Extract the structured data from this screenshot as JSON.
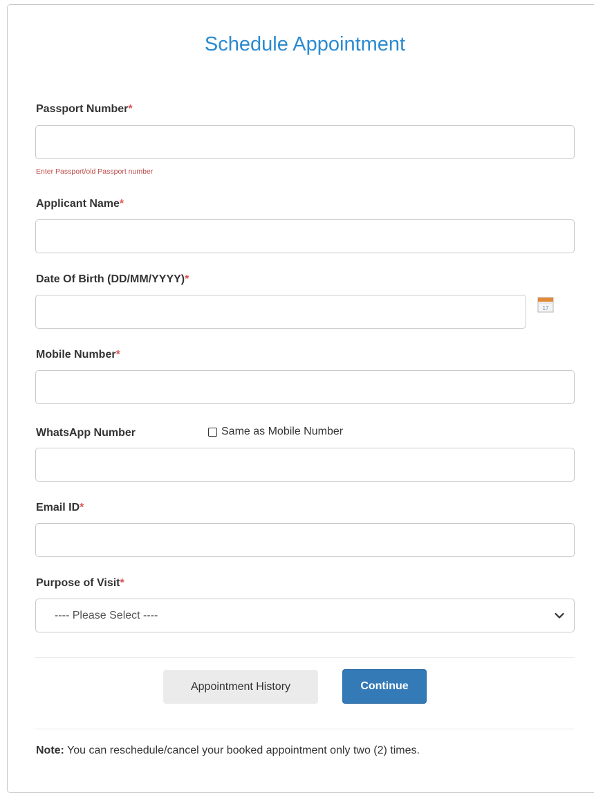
{
  "form": {
    "title": "Schedule Appointment",
    "passport": {
      "label": "Passport Number",
      "required": "*",
      "value": "",
      "hint": "Enter Passport/old Passport number"
    },
    "applicant": {
      "label": "Applicant Name",
      "required": "*",
      "value": ""
    },
    "dob": {
      "label": "Date Of Birth (DD/MM/YYYY)",
      "required": "*",
      "value": "",
      "calendar_icon": "calendar-icon",
      "calendar_day": "17"
    },
    "mobile": {
      "label": "Mobile Number",
      "required": "*",
      "value": ""
    },
    "whatsapp": {
      "label": "WhatsApp Number",
      "value": "",
      "same_checkbox_label": "Same as Mobile Number",
      "same_checked": false
    },
    "email": {
      "label": "Email ID",
      "required": "*",
      "value": ""
    },
    "purpose": {
      "label": "Purpose of Visit",
      "required": "*",
      "selected": "---- Please Select ----",
      "dropdown_icon": "chevron-down-icon"
    }
  },
  "buttons": {
    "history": "Appointment History",
    "continue": "Continue"
  },
  "note": {
    "prefix": "Note:",
    "text": " You can reschedule/cancel your booked appointment only two (2) times."
  },
  "colors": {
    "title": "#2b8ad0",
    "required": "#d9534f",
    "hint": "#b94a48",
    "primary_button": "#337ab7",
    "secondary_button": "#ebebeb"
  }
}
